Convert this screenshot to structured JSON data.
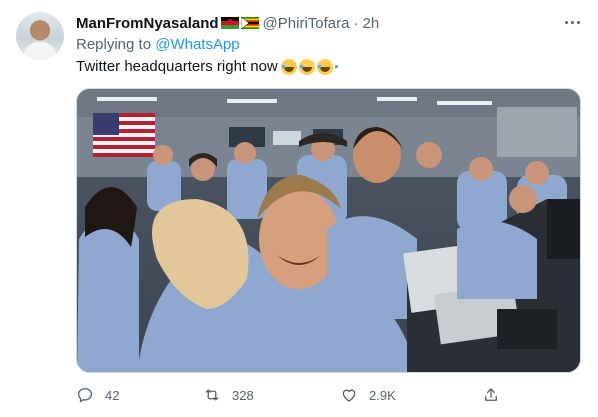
{
  "tweet": {
    "display_name": "ManFromNyasaland",
    "handle": "@PhiriTofara",
    "separator": "·",
    "time": "2h",
    "replying_prefix": "Replying to",
    "replying_to": "@WhatsApp",
    "text": "Twitter headquarters right now",
    "emoji": [
      "face-with-tears-of-joy-emoji",
      "face-with-tears-of-joy-emoji",
      "face-with-tears-of-joy-emoji"
    ],
    "flags": [
      "malawi-flag-icon",
      "zimbabwe-flag-icon"
    ]
  },
  "actions": {
    "replies": "42",
    "retweets": "328",
    "likes": "2.9K"
  },
  "colors": {
    "link": "#1d9bf0",
    "secondary_text": "#536471",
    "primary_text": "#0f1419",
    "border": "#cfd9de"
  }
}
